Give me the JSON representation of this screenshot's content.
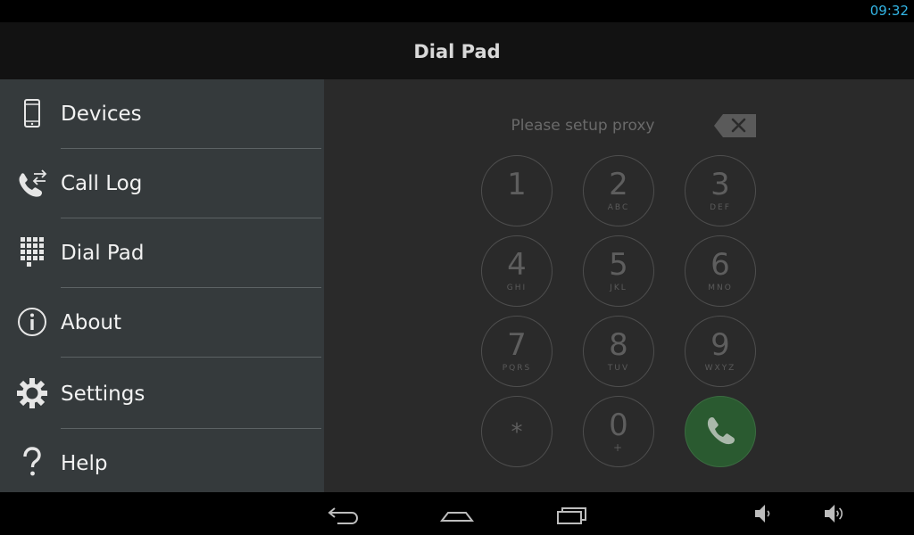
{
  "status_bar": {
    "time": "09:32"
  },
  "action_bar": {
    "title": "Dial Pad"
  },
  "drawer": {
    "items": [
      {
        "label": "Devices",
        "icon": "phone-device-icon"
      },
      {
        "label": "Call Log",
        "icon": "call-log-icon"
      },
      {
        "label": "Dial Pad",
        "icon": "dialpad-icon"
      },
      {
        "label": "About",
        "icon": "info-icon"
      },
      {
        "label": "Settings",
        "icon": "gear-icon"
      },
      {
        "label": "Help",
        "icon": "question-icon"
      }
    ]
  },
  "dialer": {
    "number_placeholder": "Please setup proxy",
    "keys": [
      {
        "digit": "1",
        "letters": ""
      },
      {
        "digit": "2",
        "letters": "ABC"
      },
      {
        "digit": "3",
        "letters": "DEF"
      },
      {
        "digit": "4",
        "letters": "GHI"
      },
      {
        "digit": "5",
        "letters": "JKL"
      },
      {
        "digit": "6",
        "letters": "MNO"
      },
      {
        "digit": "7",
        "letters": "PQRS"
      },
      {
        "digit": "8",
        "letters": "TUV"
      },
      {
        "digit": "9",
        "letters": "WXYZ"
      },
      {
        "digit": "*",
        "letters": ""
      },
      {
        "digit": "0",
        "letters": "+"
      }
    ],
    "call_button_color": "#2a5a30"
  },
  "nav_bar": {
    "buttons": [
      "back-icon",
      "home-icon",
      "recent-apps-icon",
      "volume-down-icon",
      "volume-up-icon"
    ]
  },
  "colors": {
    "accent": "#33b5e5",
    "drawer_bg": "#353a3c"
  }
}
